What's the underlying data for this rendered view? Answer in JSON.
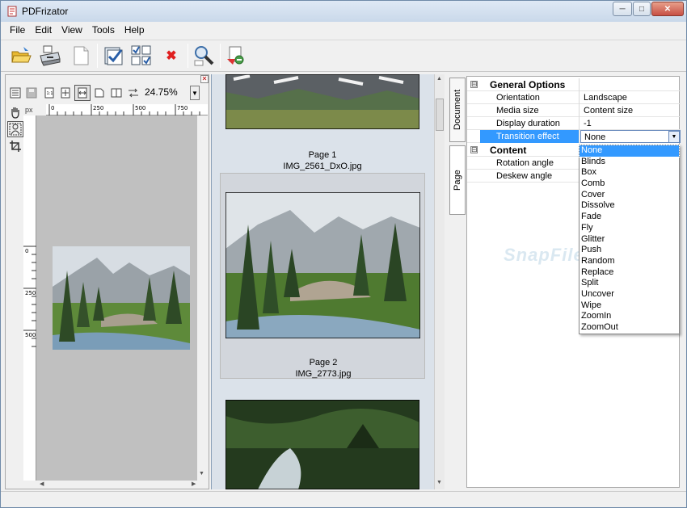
{
  "window": {
    "title": "PDFrizator",
    "controls": {
      "minimize": "─",
      "maximize": "□",
      "close": "✕"
    }
  },
  "menu": [
    "File",
    "Edit",
    "View",
    "Tools",
    "Help"
  ],
  "toolbar": {
    "buttons": [
      "open-folder-icon",
      "scan-icon",
      "new-document-icon",
      "check-page-icon",
      "select-pages-icon",
      "delete-icon",
      "find-icon",
      "convert-icon"
    ],
    "delete_glyph": "✖"
  },
  "preview": {
    "zoom": "24.75%",
    "unit": "px",
    "ruler_ticks": [
      "0",
      "250",
      "500",
      "750"
    ],
    "vruler_ticks": [
      "0",
      "250",
      "500"
    ],
    "close_glyph": "✕"
  },
  "thumbnails": {
    "pages": [
      {
        "label": "Page 1",
        "filename": "IMG_2561_DxO.jpg"
      },
      {
        "label": "Page 2",
        "filename": "IMG_2773.jpg"
      }
    ]
  },
  "tabs": {
    "document": "Document",
    "page": "Page"
  },
  "properties": {
    "groups": [
      {
        "name": "General Options",
        "rows": [
          {
            "label": "Orientation",
            "value": "Landscape"
          },
          {
            "label": "Media size",
            "value": "Content size"
          },
          {
            "label": "Display duration",
            "value": "-1"
          },
          {
            "label": "Transition effect",
            "value": "None"
          }
        ]
      },
      {
        "name": "Content",
        "rows": [
          {
            "label": "Rotation angle",
            "value": ""
          },
          {
            "label": "Deskew angle",
            "value": ""
          }
        ]
      }
    ],
    "collapse_glyph": "⊟"
  },
  "transition_options": [
    "None",
    "Blinds",
    "Box",
    "Comb",
    "Cover",
    "Dissolve",
    "Fade",
    "Fly",
    "Glitter",
    "Push",
    "Random",
    "Replace",
    "Split",
    "Uncover",
    "Wipe",
    "ZoomIn",
    "ZoomOut"
  ],
  "watermark": "SnapFiles",
  "colors": {
    "selection": "#3399ff",
    "thumb_bg": "#dbe2ea",
    "canvas_bg": "#c0c0c0"
  }
}
